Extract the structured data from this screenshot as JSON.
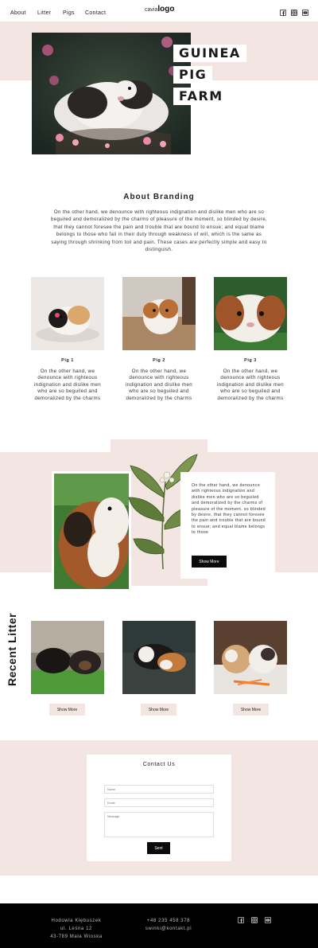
{
  "nav": {
    "links": [
      "About",
      "Litter",
      "Pigs",
      "Contact"
    ],
    "logo_prefix": "cavia",
    "logo_main": "logo",
    "social_icons": [
      "facebook-icon",
      "instagram-icon",
      "youtube-icon"
    ]
  },
  "hero": {
    "title_lines": [
      "GUINEA",
      "PIG",
      "FARM"
    ]
  },
  "about": {
    "title": "About Branding",
    "text": "On the other hand, we denounce with righteous indignation and dislike men who are so beguiled and demoralized by the charms of pleasure of the moment, so blinded by desire, that they cannot foresee the pain and trouble that are bound to ensue; and equal blame belongs to those who fail in their duty through weakness of will, which is the same as saying through shrinking from toil and pain. These cases are perfectly simple and easy to distinguish."
  },
  "pigs": [
    {
      "name": "Pig 1",
      "text": "On the other hand, we denounce with righteous indignation and dislike men who are so beguiled and demoralized by the charms"
    },
    {
      "name": "Pig 2",
      "text": "On the other hand, we denounce with righteous indignation and dislike men who are so beguiled and demoralized by the charms"
    },
    {
      "name": "Pig 3",
      "text": "On the other hand, we denounce with righteous indignation and dislike men who are so beguiled and demoralized by the charms"
    }
  ],
  "feature": {
    "text": "On the other hand, we denounce with righteous indignation and dislike men who are so beguiled and demoralized by the charms of pleasure of the moment, so blinded by desire, that they cannot foresee the pain and trouble that are bound to ensue; and equal blame belongs to those",
    "button": "Show More"
  },
  "recent": {
    "title": "Recent Litter",
    "buttons": [
      "Show More",
      "Show More",
      "Show More"
    ]
  },
  "contact": {
    "title": "Contact Us",
    "name_placeholder": "Name",
    "email_placeholder": "Email",
    "message_placeholder": "Message",
    "send": "Sent"
  },
  "footer": {
    "address": [
      "Hodowla Kłębuszek",
      "ul. Leśna 12",
      "43-789 Mała Wioska"
    ],
    "phone": "+48 235 458 378",
    "email": "swinki@kontakt.pl",
    "social_icons": [
      "facebook-icon",
      "instagram-icon",
      "youtube-icon"
    ]
  },
  "colors": {
    "accent_pink": "#f2e5e2",
    "dark": "#0b0b0b",
    "footer_bg": "#000000"
  }
}
